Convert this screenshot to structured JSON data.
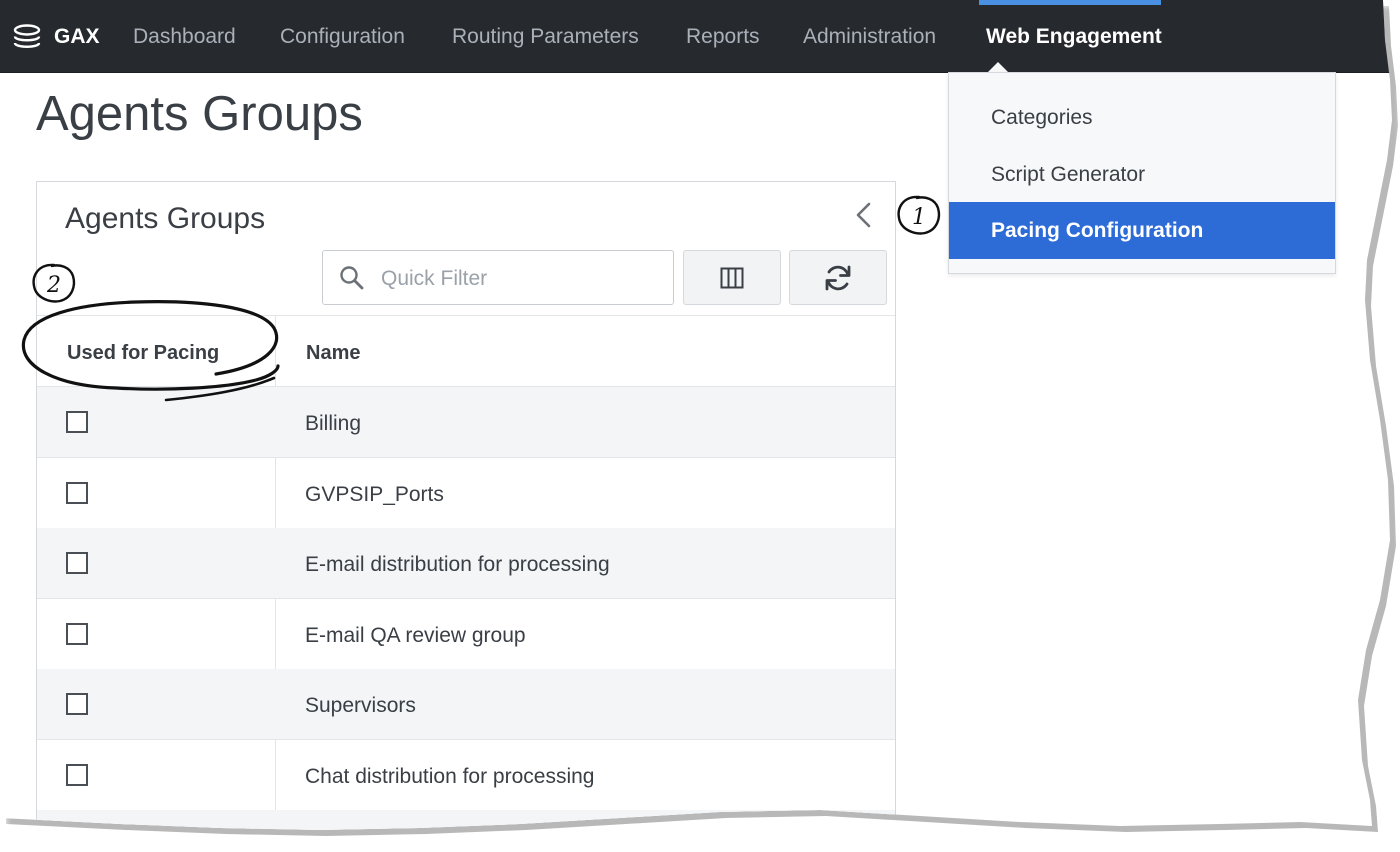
{
  "nav": {
    "brand": "GAX",
    "items": [
      {
        "label": "Dashboard"
      },
      {
        "label": "Configuration"
      },
      {
        "label": "Routing Parameters"
      },
      {
        "label": "Reports"
      },
      {
        "label": "Administration"
      },
      {
        "label": "Web Engagement"
      }
    ],
    "active_index": 5
  },
  "dropdown": {
    "items": [
      {
        "label": "Categories"
      },
      {
        "label": "Script Generator"
      },
      {
        "label": "Pacing Configuration"
      }
    ],
    "selected_index": 2
  },
  "page": {
    "title": "Agents Groups"
  },
  "panel": {
    "title": "Agents Groups",
    "filter_placeholder": "Quick Filter",
    "columns": [
      {
        "label": "Used for Pacing"
      },
      {
        "label": "Name"
      }
    ],
    "rows": [
      {
        "name": "Billing",
        "checked": false
      },
      {
        "name": "GVPSIP_Ports",
        "checked": false
      },
      {
        "name": "E-mail distribution for processing",
        "checked": false
      },
      {
        "name": "E-mail QA review group",
        "checked": false
      },
      {
        "name": "Supervisors",
        "checked": false
      },
      {
        "name": "Chat distribution for processing",
        "checked": false
      }
    ]
  },
  "annotations": {
    "callout_1": "1",
    "callout_2": "2"
  },
  "colors": {
    "topbar": "#262a2f",
    "accent": "#2d6bd6",
    "active_indicator": "#4a90e2"
  },
  "icons": [
    "database-icon",
    "search-icon",
    "columns-icon",
    "refresh-icon",
    "chevron-left-icon",
    "checkbox-icon"
  ]
}
